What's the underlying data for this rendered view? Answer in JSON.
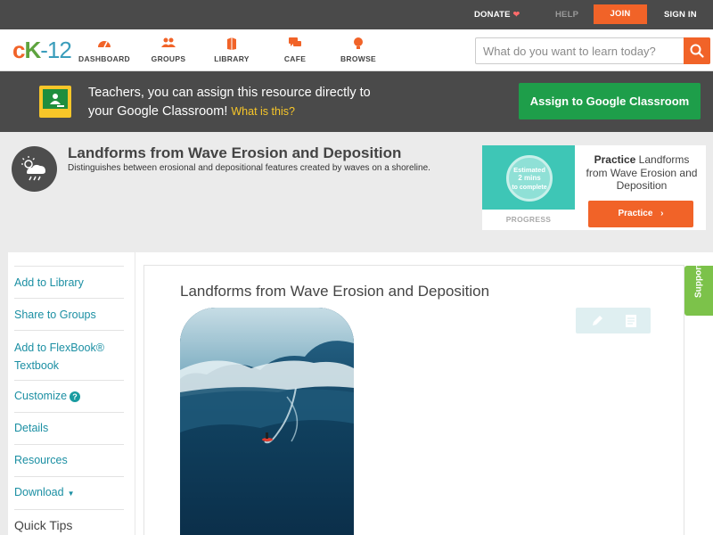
{
  "topbar": {
    "donate": "DONATE",
    "help": "HELP",
    "join": "JOIN",
    "signin": "SIGN IN"
  },
  "nav": {
    "logo": {
      "c": "c",
      "k": "K",
      "dash_12": "-12"
    },
    "items": [
      {
        "label": "DASHBOARD",
        "icon": "dashboard-icon"
      },
      {
        "label": "GROUPS",
        "icon": "groups-icon"
      },
      {
        "label": "LIBRARY",
        "icon": "library-icon"
      },
      {
        "label": "CAFE",
        "icon": "cafe-icon"
      },
      {
        "label": "BROWSE",
        "icon": "browse-icon"
      }
    ],
    "search": {
      "placeholder": "What do you want to learn today?"
    }
  },
  "banner": {
    "line1": "Teachers, you can assign this resource directly to",
    "line2": "your Google Classroom!",
    "what_link": "What is this?",
    "assign_button": "Assign to Google Classroom"
  },
  "header": {
    "title": "Landforms from Wave Erosion and Deposition",
    "subtitle": "Distinguishes between erosional and depositional features created by waves on a shoreline."
  },
  "practice": {
    "estimated": "Estimated",
    "mins": "2 mins",
    "to_complete": "to complete",
    "progress_label": "PROGRESS",
    "practice_word": "Practice",
    "practice_title": "Landforms from Wave Erosion and Deposition",
    "button": "Practice"
  },
  "sidebar": {
    "items": [
      {
        "label": "Add to Library"
      },
      {
        "label": "Share to Groups"
      },
      {
        "label": "Add to FlexBook® Textbook"
      },
      {
        "label": "Customize"
      },
      {
        "label": "Details"
      },
      {
        "label": "Resources"
      },
      {
        "label": "Download"
      }
    ],
    "quick_tips": "Quick Tips"
  },
  "content": {
    "title": "Landforms from Wave Erosion and Deposition"
  },
  "support": {
    "label": "Support"
  },
  "colors": {
    "brand_orange": "#f16328",
    "dark_bar": "#4a4a4a",
    "google_green": "#1e9e4a",
    "link_teal": "#1b8fa3",
    "support_green": "#7cc24a"
  }
}
